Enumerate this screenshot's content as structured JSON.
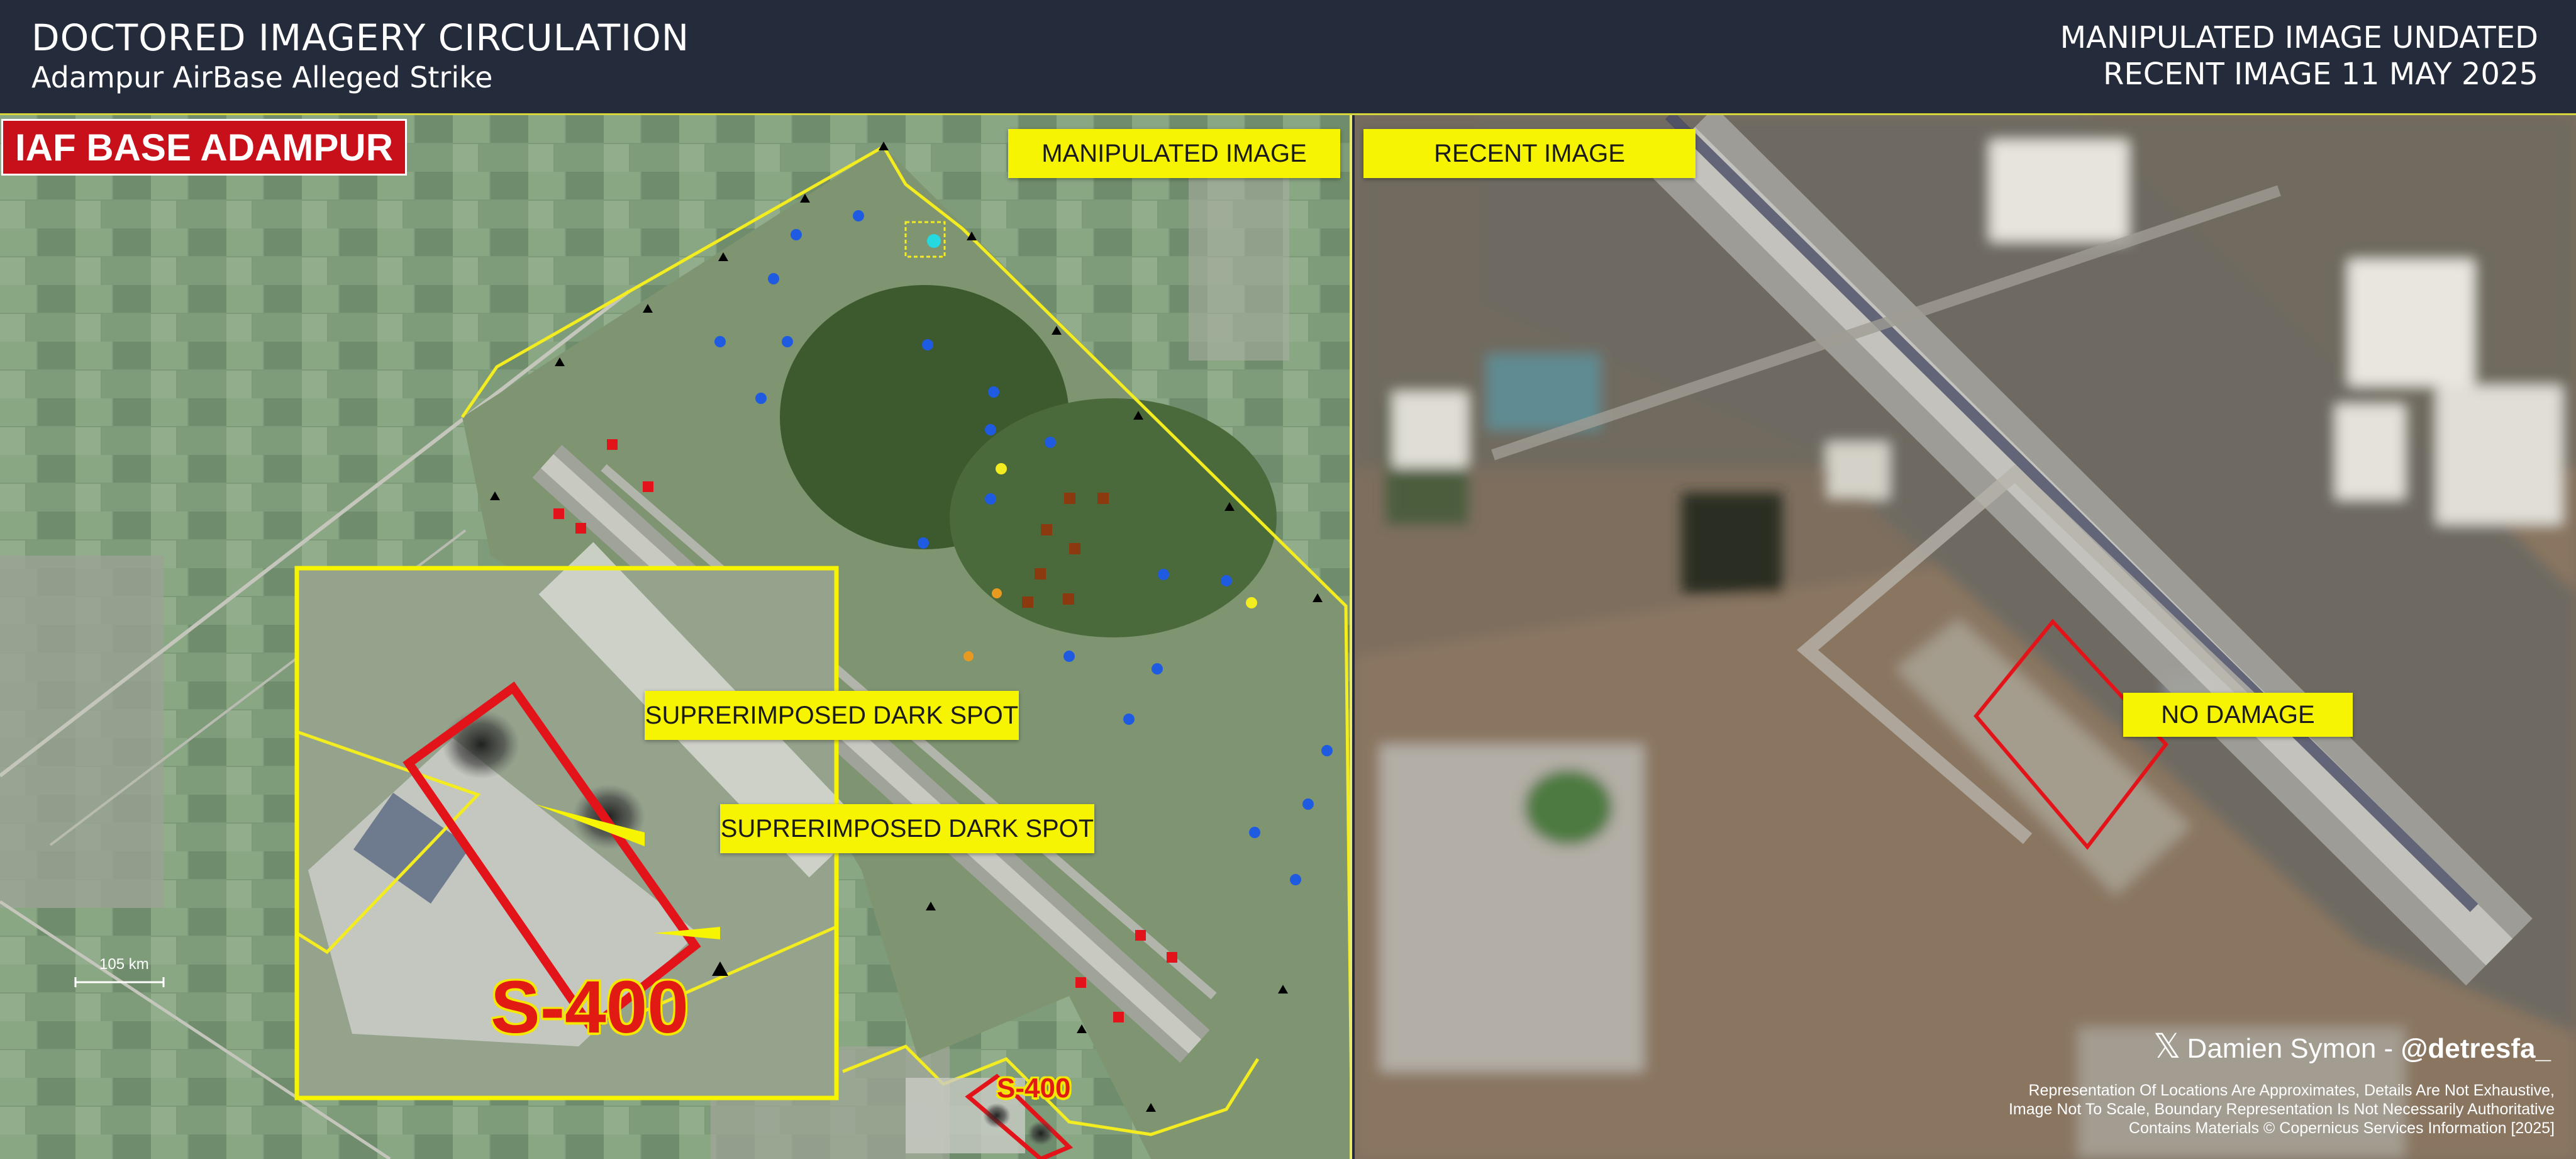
{
  "header": {
    "title": "DOCTORED IMAGERY CIRCULATION",
    "subtitle": "Adampur AirBase Alleged Strike",
    "right_line1": "MANIPULATED IMAGE UNDATED",
    "right_line2": "RECENT IMAGE 11 MAY 2025"
  },
  "left_panel": {
    "base_label": "IAF BASE ADAMPUR",
    "panel_label": "MANIPULATED IMAGE",
    "callout1": "SUPRERIMPOSED DARK SPOT",
    "callout2": "SUPRERIMPOSED DARK SPOT",
    "s400_inset": "S-400",
    "s400_small": "S-400",
    "scale_text": "105 km"
  },
  "right_panel": {
    "panel_label": "RECENT IMAGE",
    "callout": "NO DAMAGE"
  },
  "credit": {
    "x_glyph": "𝕏",
    "name": "Damien Symon - ",
    "handle": "@detresfa_"
  },
  "disclaimer": {
    "line1": "Representation Of Locations Are Approximates, Details Are Not Exhaustive,",
    "line2": "Image Not To Scale, Boundary Representation Is Not Necessarily Authoritative",
    "line3": "Contains Materials © Copernicus Services Information  [2025]"
  },
  "colors": {
    "header_bg": "#242b3a",
    "label_yellow": "#f6f400",
    "boundary_yellow": "#f2ec20",
    "alert_red": "#e2141a",
    "marker_blue": "#1f5be0",
    "marker_brown": "#8b3a10",
    "marker_black": "#000000"
  }
}
